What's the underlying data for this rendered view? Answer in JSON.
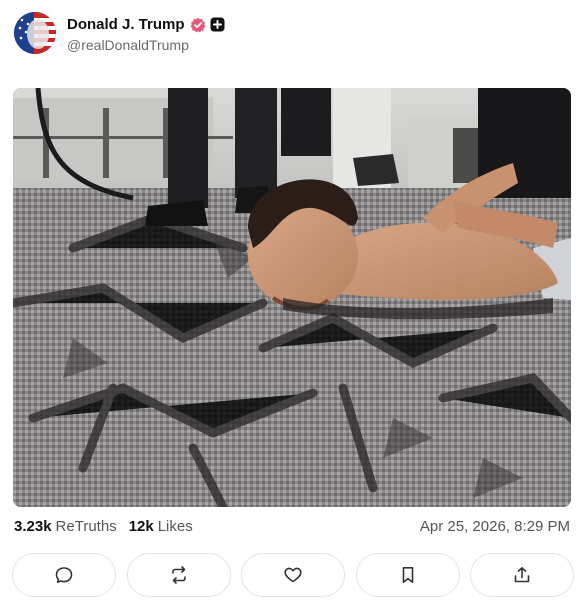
{
  "post": {
    "author": {
      "display_name": "Donald J. Trump",
      "handle": "@realDonaldTrump",
      "verified_icon": "verified-badge-icon",
      "plus_icon": "plus-badge-icon",
      "avatar_icon": "american-flag-avatar"
    },
    "image": {
      "description_icon": "post-photo"
    },
    "stats": {
      "retruths_count": "3.23k",
      "retruths_label": "ReTruths",
      "likes_count": "12k",
      "likes_label": "Likes"
    },
    "timestamp": "Apr 25, 2026, 8:29 PM",
    "actions": [
      {
        "name": "reply",
        "icon": "reply-bubble-icon"
      },
      {
        "name": "retruth",
        "icon": "retruth-arrows-icon"
      },
      {
        "name": "like",
        "icon": "heart-icon"
      },
      {
        "name": "bookmark",
        "icon": "bookmark-icon"
      },
      {
        "name": "share",
        "icon": "share-upload-icon"
      }
    ]
  },
  "colors": {
    "verified": "#e8567a",
    "text": "#111111",
    "muted": "#6b6b6b",
    "border": "#e3e3e3"
  }
}
